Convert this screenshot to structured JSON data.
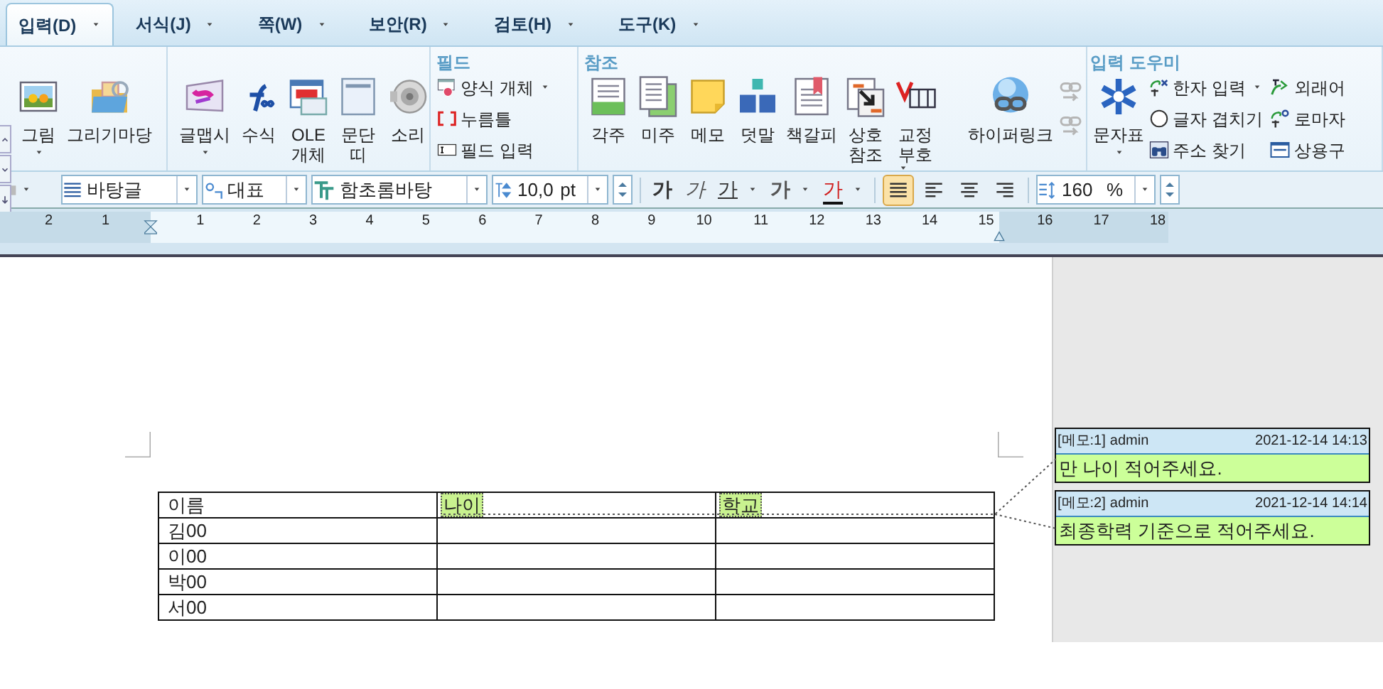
{
  "tabs": [
    {
      "label": "입력(D)",
      "selected": true
    },
    {
      "label": "서식(J)",
      "selected": false
    },
    {
      "label": "쪽(W)",
      "selected": false
    },
    {
      "label": "보안(R)",
      "selected": false
    },
    {
      "label": "검토(H)",
      "selected": false
    },
    {
      "label": "도구(K)",
      "selected": false
    }
  ],
  "ribbon": {
    "groups": [
      {
        "items": [
          {
            "kind": "large",
            "lines": [
              "그림"
            ],
            "dropdown": true
          },
          {
            "kind": "large",
            "lines": [
              "그리기마당"
            ],
            "dropdown": false
          }
        ]
      },
      {
        "items": [
          {
            "kind": "large",
            "lines": [
              "글맵시"
            ],
            "dropdown": true
          },
          {
            "kind": "large",
            "lines": [
              "수식"
            ],
            "dropdown": false
          },
          {
            "kind": "large",
            "lines": [
              "OLE",
              "개체"
            ],
            "dropdown": false
          },
          {
            "kind": "large",
            "lines": [
              "문단",
              "띠"
            ],
            "dropdown": false
          },
          {
            "kind": "large",
            "lines": [
              "소리"
            ],
            "dropdown": false
          }
        ]
      },
      {
        "title": "필드",
        "items": [
          {
            "kind": "small",
            "lines": [
              "양식 개체"
            ],
            "dropdown": true
          },
          {
            "kind": "small",
            "lines": [
              "누름틀"
            ],
            "dropdown": false
          },
          {
            "kind": "small",
            "lines": [
              "필드 입력"
            ],
            "dropdown": false
          }
        ]
      },
      {
        "title": "참조",
        "items": [
          {
            "kind": "large",
            "lines": [
              "각주"
            ],
            "dropdown": false
          },
          {
            "kind": "large",
            "lines": [
              "미주"
            ],
            "dropdown": false
          },
          {
            "kind": "large",
            "lines": [
              "메모"
            ],
            "dropdown": false
          },
          {
            "kind": "large",
            "lines": [
              "덧말"
            ],
            "dropdown": false
          },
          {
            "kind": "large",
            "lines": [
              "책갈피"
            ],
            "dropdown": false
          },
          {
            "kind": "large",
            "lines": [
              "상호",
              "참조"
            ],
            "dropdown": false
          },
          {
            "kind": "large",
            "lines": [
              "교정",
              "부호"
            ],
            "dropdown": true
          },
          {
            "kind": "separator"
          },
          {
            "kind": "large",
            "lines": [
              "하이퍼링크"
            ],
            "dropdown": false
          },
          {
            "kind": "icon"
          }
        ]
      },
      {
        "title": "입력 도우미",
        "items": [
          {
            "kind": "large",
            "lines": [
              "문자표"
            ],
            "dropdown": true
          },
          {
            "kind": "small",
            "lines": [
              "한자 입력"
            ],
            "dropdown": true
          },
          {
            "kind": "small",
            "lines": [
              "글자 겹치기"
            ],
            "dropdown": false
          },
          {
            "kind": "small",
            "lines": [
              "주소 찾기"
            ],
            "dropdown": false
          },
          {
            "kind": "small",
            "lines": [
              "외래어"
            ],
            "dropdown": false
          },
          {
            "kind": "small",
            "lines": [
              "로마자"
            ],
            "dropdown": false
          },
          {
            "kind": "small",
            "lines": [
              "상용구"
            ],
            "dropdown": false
          }
        ]
      }
    ]
  },
  "toolbar": {
    "style": "바탕글",
    "language": "대표",
    "font": "함초롬바탕",
    "size": "10,0",
    "size_unit": "pt",
    "format_buttons": [
      {
        "kind": "bold",
        "label": "가",
        "dropdown": false
      },
      {
        "kind": "italic",
        "label": "가",
        "dropdown": false
      },
      {
        "kind": "underline",
        "label": "가",
        "dropdown": true
      },
      {
        "kind": "outline",
        "label": "가",
        "dropdown": true
      },
      {
        "kind": "color",
        "label": "가",
        "dropdown": true
      }
    ],
    "alignments": [
      {
        "kind": "justify",
        "selected": true
      },
      {
        "kind": "left",
        "selected": false
      },
      {
        "kind": "center",
        "selected": false
      },
      {
        "kind": "right",
        "selected": false
      }
    ],
    "line_spacing": "160",
    "line_spacing_unit": "%"
  },
  "ruler": {
    "left_labels": [
      "2",
      "1"
    ],
    "labels": [
      "1",
      "2",
      "3",
      "4",
      "5",
      "6",
      "7",
      "8",
      "9",
      "10",
      "11",
      "12",
      "13",
      "14",
      "15",
      "16",
      "17",
      "18"
    ]
  },
  "document": {
    "table": {
      "columns": [
        {
          "text": "이름",
          "memo": false
        },
        {
          "text": "나이",
          "memo": true
        },
        {
          "text": "학교",
          "memo": true
        }
      ],
      "rows": [
        {
          "name": "김00"
        },
        {
          "name": "이00"
        },
        {
          "name": "박00"
        },
        {
          "name": "서00"
        }
      ]
    }
  },
  "memos": [
    {
      "number": "[메모:1]",
      "author": "admin",
      "time": "2021-12-14 14:13",
      "text": "만 나이 적어주세요."
    },
    {
      "number": "[메모:2]",
      "author": "admin",
      "time": "2021-12-14 14:14",
      "text": "최종학력 기준으로 적어주세요."
    }
  ]
}
